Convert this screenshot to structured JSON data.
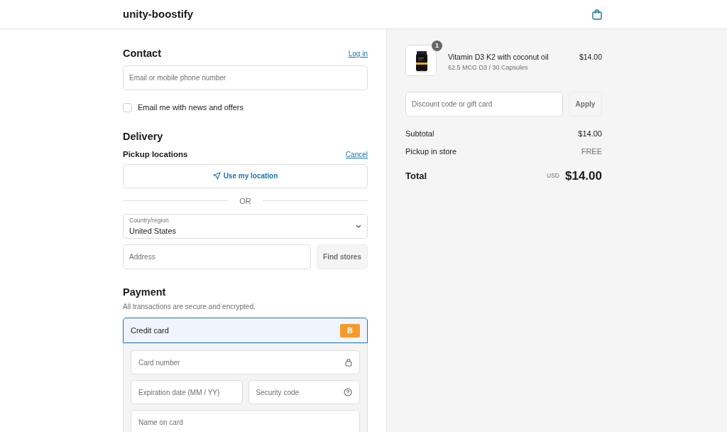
{
  "header": {
    "brand": "unity-boostify"
  },
  "contact": {
    "title": "Contact",
    "login": "Log in",
    "email_placeholder": "Email or mobile phone number",
    "newsletter": {
      "label": "Email me with news and offers",
      "checked": false
    }
  },
  "delivery": {
    "title": "Delivery",
    "pickup_title": "Pickup locations",
    "cancel": "Cancel",
    "use_location": "Use my location",
    "divider": "OR",
    "country": {
      "label": "Country/region",
      "value": "United States"
    },
    "address_placeholder": "Address",
    "find_button": "Find stores"
  },
  "payment": {
    "title": "Payment",
    "subtitle": "All transactions are secure and encrypted.",
    "methods": [
      {
        "label": "Credit card",
        "badge": "B",
        "selected": true
      }
    ],
    "fields": [
      {
        "placeholder": "Card number",
        "kind": "lock"
      },
      {
        "placeholder": "Expiration date (MM / YY)",
        "kind": "plain"
      },
      {
        "placeholder": "Security code",
        "kind": "help"
      },
      {
        "placeholder": "Name on card",
        "kind": "plain"
      }
    ]
  },
  "summary": {
    "items": [
      {
        "quantity": "1",
        "name": "Vitamin D3 K2 with coconut oil",
        "variant": "62.5 MCG D3 / 30 Capsules",
        "price": "$14.00"
      }
    ],
    "discount_placeholder": "Discount code or gift card",
    "apply": "Apply",
    "lines": [
      {
        "label": "Subtotal",
        "value": "$14.00",
        "muted": false
      },
      {
        "label": "Pickup in store",
        "value": "FREE",
        "muted": true
      }
    ],
    "total": {
      "label": "Total",
      "currency": "USD",
      "value": "$14.00"
    }
  }
}
